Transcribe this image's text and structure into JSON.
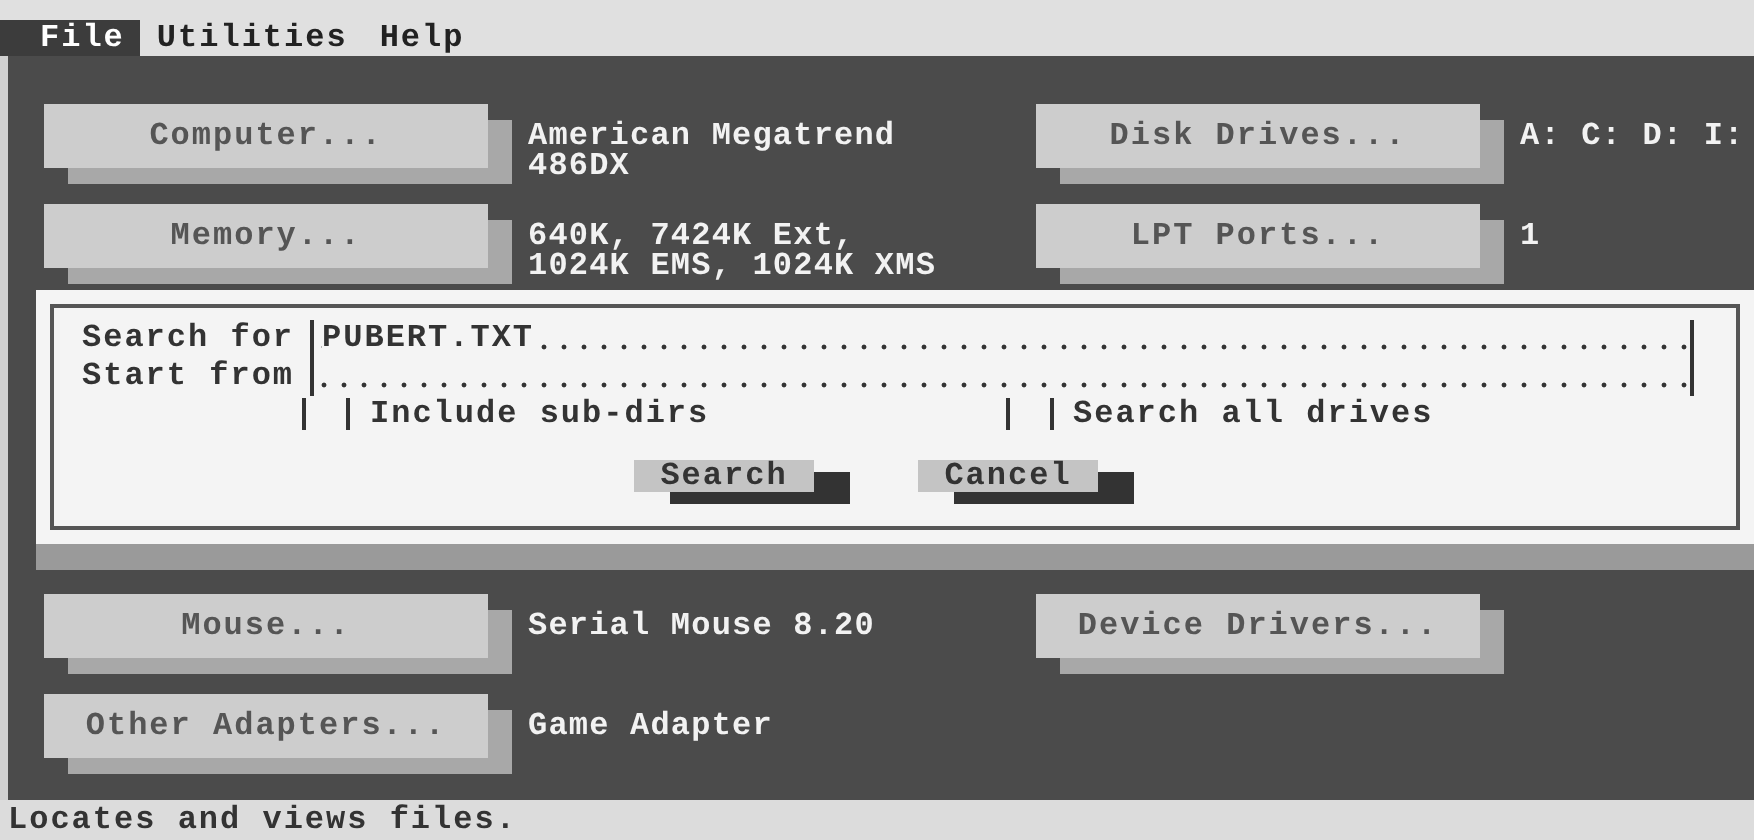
{
  "menu": [
    {
      "label": "File",
      "selected": true
    },
    {
      "label": "Utilities",
      "selected": false
    },
    {
      "label": "Help",
      "selected": false
    }
  ],
  "info_left": [
    {
      "button": "Computer...",
      "value": "American Megatrend\n486DX"
    },
    {
      "button": "Memory...",
      "value": "640K, 7424K Ext,\n1024K EMS, 1024K XMS"
    }
  ],
  "info_right": [
    {
      "button": "Disk Drives...",
      "value": "A: C: D: I:"
    },
    {
      "button": "LPT Ports...",
      "value": "1"
    }
  ],
  "info_left_lower": [
    {
      "button": "Mouse...",
      "value": "Serial Mouse 8.20"
    },
    {
      "button": "Other Adapters...",
      "value": "Game Adapter"
    }
  ],
  "info_right_lower": [
    {
      "button": "Device Drivers..."
    }
  ],
  "dialog": {
    "fields": [
      {
        "label": "Search for",
        "value": "PUBERT.TXT"
      },
      {
        "label": "Start from"
      }
    ],
    "checkboxes": [
      {
        "label": "Include sub-dirs",
        "checked": false
      },
      {
        "label": "Search all drives",
        "checked": false
      }
    ],
    "buttons": [
      "Search",
      "Cancel"
    ]
  },
  "status_bar": "Locates and views files."
}
